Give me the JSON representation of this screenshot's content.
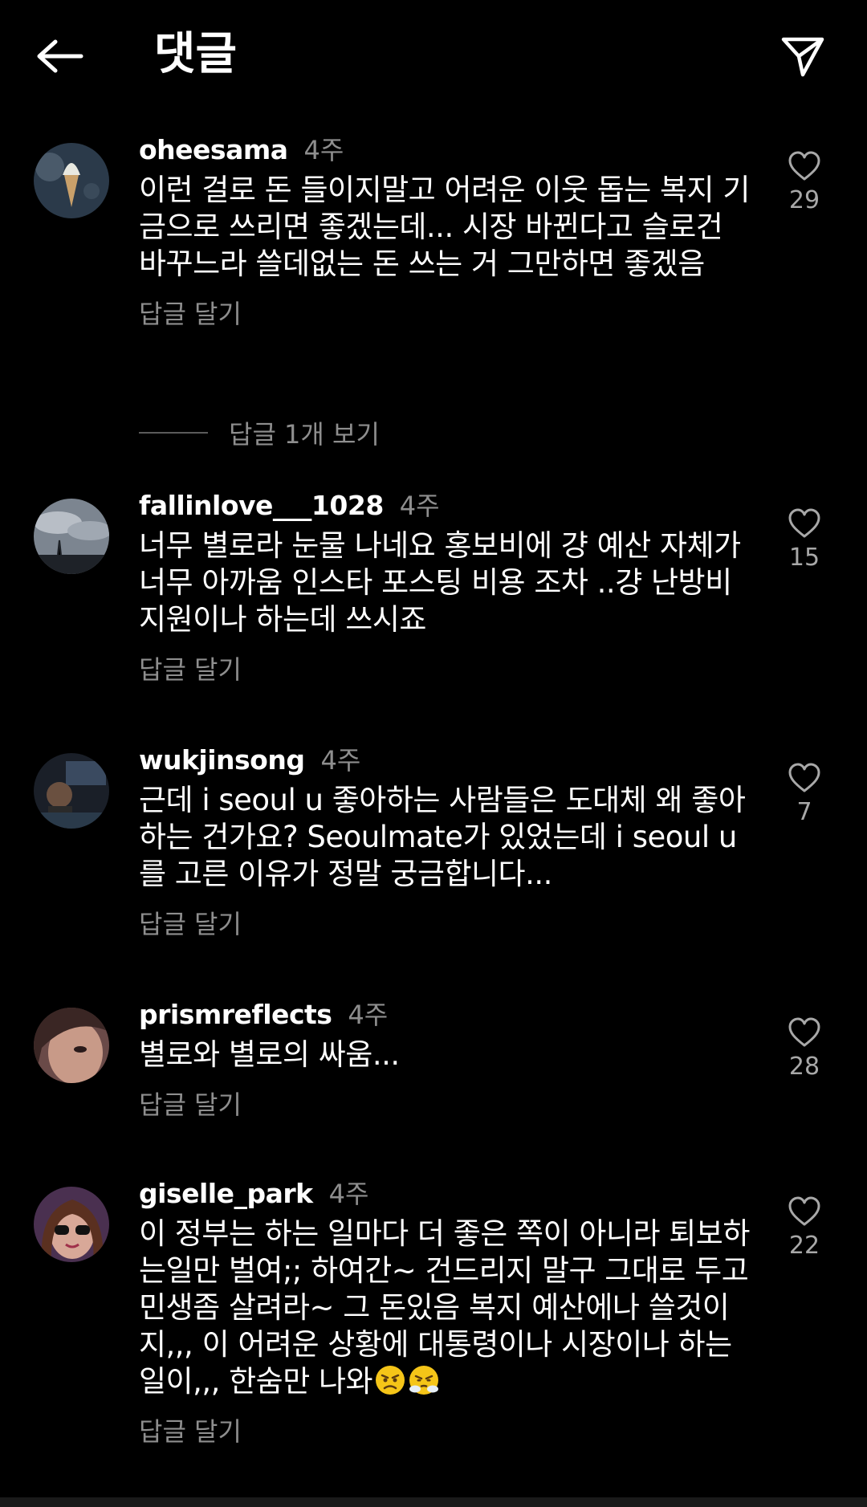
{
  "header": {
    "title": "댓글",
    "back_icon": "arrow-left-icon",
    "send_icon": "paper-plane-icon"
  },
  "colors": {
    "background": "#000000",
    "text": "#ffffff",
    "muted": "#8e8e8e"
  },
  "comments": [
    {
      "username": "oheesama",
      "time": "4주",
      "text": "이런 걸로 돈 들이지말고 어려운 이웃 돕는 복지 기금으로 쓰리면 좋겠는데... 시장 바뀐다고 슬로건 바꾸느라 쓸데없는 돈 쓰는 거 그만하면 좋겠음",
      "reply_label": "답글 달기",
      "likes": "29",
      "view_replies": "답글 1개 보기"
    },
    {
      "username": "fallinlove___1028",
      "time": "4주",
      "text": "너무 별로라 눈물 나네요 홍보비에 걍 예산 자체가 너무 아까움 인스타 포스팅 비용 조차 ..걍 난방비 지원이나 하는데 쓰시죠",
      "reply_label": "답글 달기",
      "likes": "15"
    },
    {
      "username": "wukjinsong",
      "time": "4주",
      "text": "근데 i seoul u 좋아하는 사람들은 도대체 왜 좋아하는 건가요? Seoulmate가 있었는데 i seoul u를 고른 이유가 정말 궁금합니다...",
      "reply_label": "답글 달기",
      "likes": "7"
    },
    {
      "username": "prismreflects",
      "time": "4주",
      "text": "별로와 별로의 싸움...",
      "reply_label": "답글 달기",
      "likes": "28"
    },
    {
      "username": "giselle_park",
      "time": "4주",
      "text": "이 정부는 하는 일마다 더 좋은 쪽이 아니라 퇴보하는일만 벌여;; 하여간~ 건드리지 말구 그대로 두고 민생좀 살려라~ 그 돈있음 복지 예산에나 쓸것이지,,, 이 어려운 상황에 대통령이나 시장이나 하는 일이,,, 한숨만 나와",
      "reply_label": "답글 달기",
      "likes": "22"
    }
  ]
}
